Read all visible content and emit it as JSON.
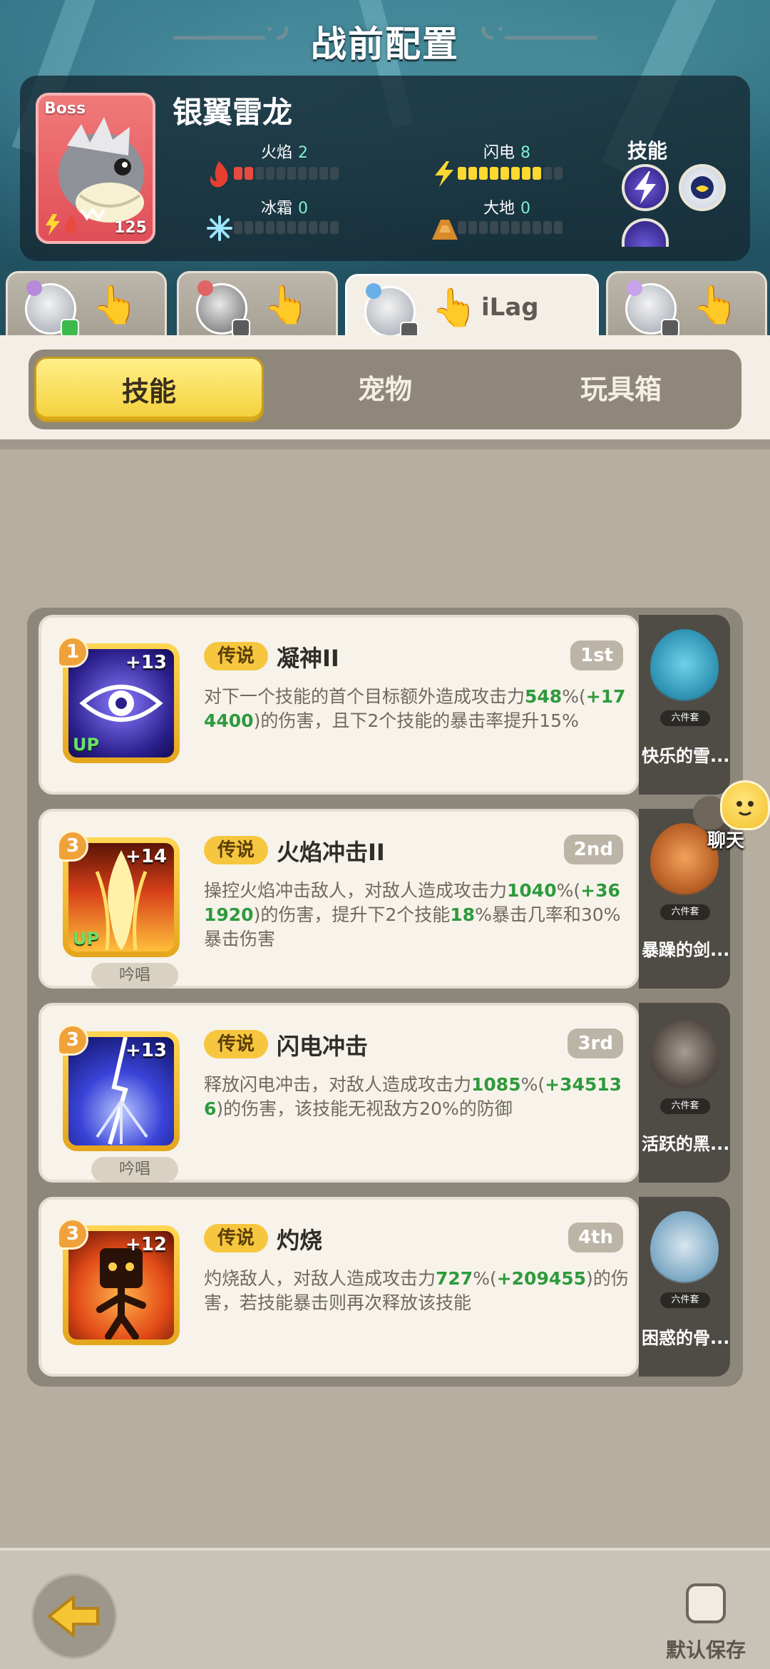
{
  "title": "战前配置",
  "boss": {
    "tag": "Boss",
    "name": "银翼雷龙",
    "level": "125",
    "stats": [
      {
        "label": "火焰",
        "value": "2",
        "filled": 2,
        "total": 10,
        "color": "red"
      },
      {
        "label": "闪电",
        "value": "8",
        "filled": 8,
        "total": 10,
        "color": "yellow"
      },
      {
        "label": "冰霜",
        "value": "0",
        "filled": 0,
        "total": 10,
        "color": "none"
      },
      {
        "label": "大地",
        "value": "0",
        "filled": 0,
        "total": 10,
        "color": "none"
      }
    ],
    "skills_label": "技能"
  },
  "players": [
    {
      "name": "",
      "badge": "green"
    },
    {
      "name": "",
      "badge": "gray"
    },
    {
      "name": "iLag",
      "badge": "gray",
      "active": true
    },
    {
      "name": "",
      "badge": "gray"
    }
  ],
  "segment_tabs": [
    "技能",
    "宠物",
    "玩具箱"
  ],
  "skills": [
    {
      "level": "1",
      "plus": "+13",
      "up": "UP",
      "chant": "",
      "rarity": "传说",
      "name": "凝神II",
      "rank": "1st",
      "desc_parts": [
        {
          "t": "对下一个技能的首个目标额外造成攻击力",
          "g": false
        },
        {
          "t": "548",
          "g": true
        },
        {
          "t": "%(",
          "g": false
        },
        {
          "t": "+174400",
          "g": true
        },
        {
          "t": ")的伤害，且下2个技能的暴击率提升15%",
          "g": false
        }
      ],
      "pet_name": "快乐的雪...",
      "pet_set": "六件套"
    },
    {
      "level": "3",
      "plus": "+14",
      "up": "UP",
      "chant": "吟唱",
      "rarity": "传说",
      "name": "火焰冲击II",
      "rank": "2nd",
      "desc_parts": [
        {
          "t": "操控火焰冲击敌人，对敌人造成攻击力",
          "g": false
        },
        {
          "t": "1040",
          "g": true
        },
        {
          "t": "%(",
          "g": false
        },
        {
          "t": "+361920",
          "g": true
        },
        {
          "t": ")的伤害，提升下2个技能",
          "g": false
        },
        {
          "t": "18",
          "g": true
        },
        {
          "t": "%暴击几率和30%暴击伤害",
          "g": false
        }
      ],
      "pet_name": "暴躁的剑...",
      "pet_set": "六件套"
    },
    {
      "level": "3",
      "plus": "+13",
      "up": "",
      "chant": "吟唱",
      "rarity": "传说",
      "name": "闪电冲击",
      "rank": "3rd",
      "desc_parts": [
        {
          "t": "释放闪电冲击，对敌人造成攻击力",
          "g": false
        },
        {
          "t": "1085",
          "g": true
        },
        {
          "t": "%(",
          "g": false
        },
        {
          "t": "+345136",
          "g": true
        },
        {
          "t": ")的伤害，该技能无视敌方20%的防御",
          "g": false
        }
      ],
      "pet_name": "活跃的黑...",
      "pet_set": "六件套"
    },
    {
      "level": "3",
      "plus": "+12",
      "up": "",
      "chant": "",
      "rarity": "传说",
      "name": "灼烧",
      "rank": "4th",
      "desc_parts": [
        {
          "t": "灼烧敌人，对敌人造成攻击力",
          "g": false
        },
        {
          "t": "727",
          "g": true
        },
        {
          "t": "%(",
          "g": false
        },
        {
          "t": "+209455",
          "g": true
        },
        {
          "t": ")的伤害，若技能暴击则再次释放该技能",
          "g": false
        }
      ],
      "pet_name": "困惑的骨...",
      "pet_set": "六件套"
    }
  ],
  "chat_label": "聊天",
  "save_label": "默认保存",
  "colors": {
    "accent": "#f4cf39",
    "green": "#2e9a3d",
    "panel": "#8d867a"
  }
}
